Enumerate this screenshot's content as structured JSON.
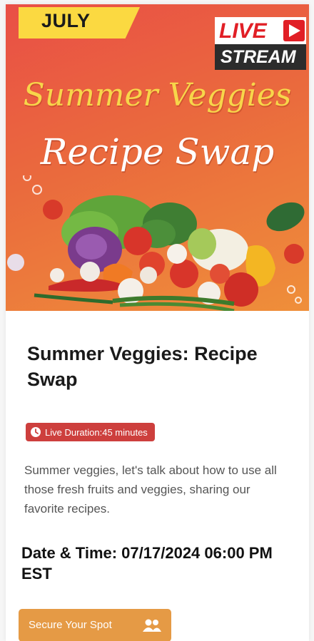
{
  "hero": {
    "month_tag": "JULY",
    "live_label": "LIVE",
    "stream_label": "STREAM",
    "title_line1": "Summer Veggies",
    "title_line2": "Recipe Swap",
    "colors": {
      "gradient_start": "#e94f46",
      "gradient_end": "#ef8f3a",
      "tag_yellow": "#fbd941",
      "live_red": "#e11f26"
    }
  },
  "event": {
    "title": "Summer Veggies: Recipe Swap",
    "duration_label": "Live Duration:45 minutes",
    "description": "Summer veggies, let's talk about how to use all those fresh fruits and veggies, sharing our favorite recipes.",
    "datetime": "Date & Time: 07/17/2024 06:00 PM EST"
  },
  "cta": {
    "label": "Secure Your Spot",
    "icon": "people-icon",
    "color": "#e59a45"
  },
  "badge_color": "#cd3f3d"
}
